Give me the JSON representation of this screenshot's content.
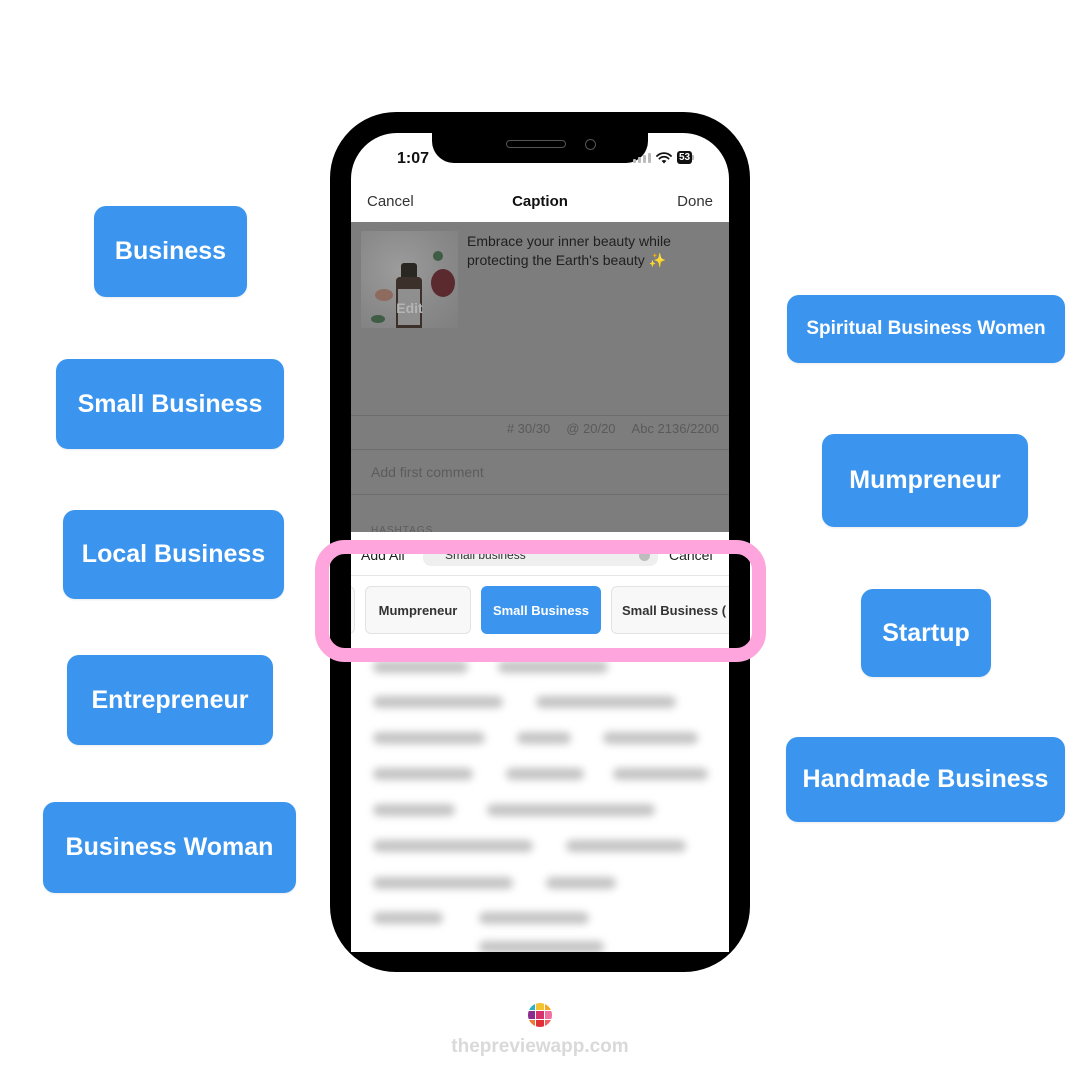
{
  "colors": {
    "tag_blue": "#3b95ee",
    "highlight_pink": "#fda5dc",
    "dim_overlay": "#7d7d7d"
  },
  "left_tags": [
    "Business",
    "Small Business",
    "Local Business",
    "Entrepreneur",
    "Business Woman"
  ],
  "right_tags": [
    "Spiritual Business Women",
    "Mumpreneur",
    "Startup",
    "Handmade Business"
  ],
  "phone": {
    "status_bar": {
      "time": "1:07",
      "battery": "53",
      "icons": [
        "signal-icon",
        "wifi-icon",
        "battery-icon"
      ]
    },
    "nav": {
      "cancel": "Cancel",
      "title": "Caption",
      "done": "Done"
    },
    "post": {
      "thumbnail_label": "Edit",
      "caption": "Embrace your inner beauty while protecting the Earth's beauty ✨"
    },
    "counters": {
      "hashtags": "# 30/30",
      "mentions": "@ 20/20",
      "characters": "Abc 2136/2200"
    },
    "comment_placeholder": "Add first comment",
    "section_label": "HASHTAGS",
    "search": {
      "add_all": "Add All",
      "query": "Small business",
      "cancel": "Cancel"
    },
    "chips": [
      {
        "label": "Mumpreneur",
        "active": false
      },
      {
        "label": "Small Business",
        "active": true
      },
      {
        "label": "Small Business (",
        "active": false
      }
    ]
  },
  "footer": {
    "site": "thepreviewapp.com"
  }
}
